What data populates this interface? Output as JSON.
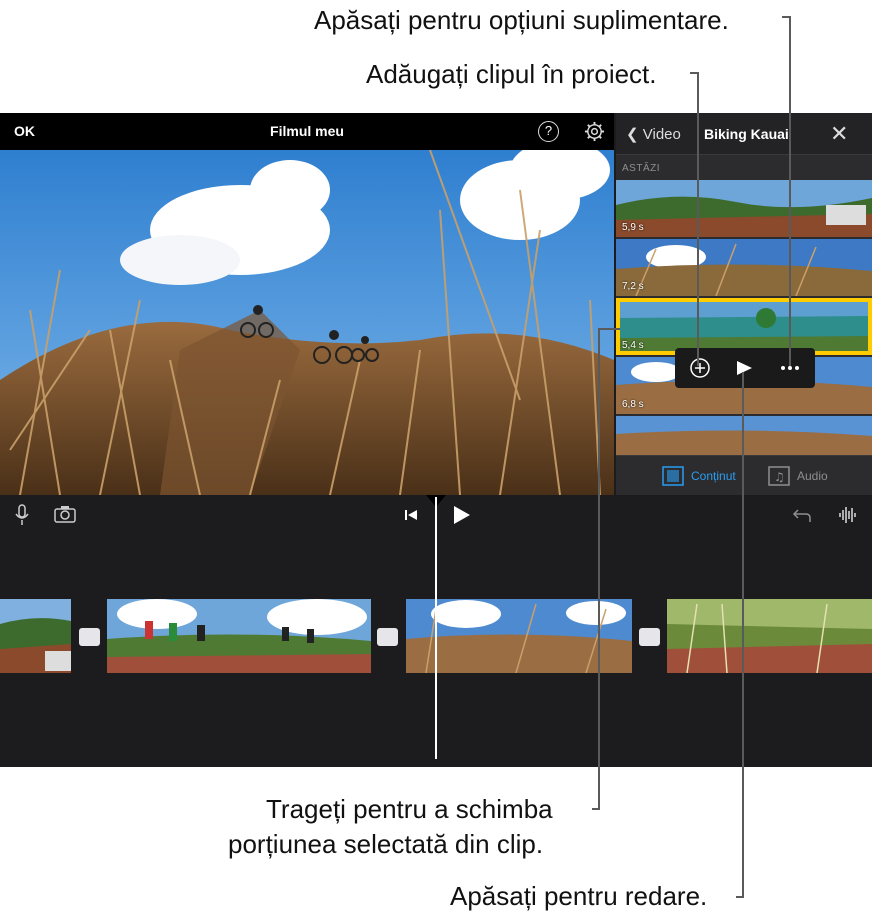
{
  "callouts": {
    "more_options": "Apăsați pentru opțiuni suplimentare.",
    "add_clip": "Adăugați clipul în proiect.",
    "drag_selection_line1": "Trageți pentru a schimba",
    "drag_selection_line2": "porțiunea selectată din clip.",
    "tap_play": "Apăsați pentru redare."
  },
  "topbar": {
    "done_label": "OK",
    "project_title": "Filmul meu",
    "help_label": "?"
  },
  "browser": {
    "back_label": "Video",
    "album_title": "Biking Kauai",
    "close_label": "✕",
    "section_label": "ASTĂZI",
    "clips": [
      {
        "duration": "5,9 s"
      },
      {
        "duration": "7,2 s"
      },
      {
        "duration": "5,4 s"
      },
      {
        "duration": "6,8 s"
      },
      {
        "duration": ""
      }
    ],
    "tab_content": "Conținut",
    "tab_audio": "Audio"
  },
  "colors": {
    "accent": "#2a9df4",
    "selection": "#ffcc00",
    "app_bg": "#1c1c1e",
    "bar_bg": "#000000"
  },
  "icons": [
    "chevron-left-icon",
    "close-icon",
    "help-icon",
    "gear-icon",
    "add-icon",
    "play-icon",
    "more-icon",
    "film-icon",
    "music-icon",
    "microphone-icon",
    "camera-icon",
    "skip-back-icon",
    "undo-icon",
    "waveform-icon",
    "transition-icon"
  ]
}
